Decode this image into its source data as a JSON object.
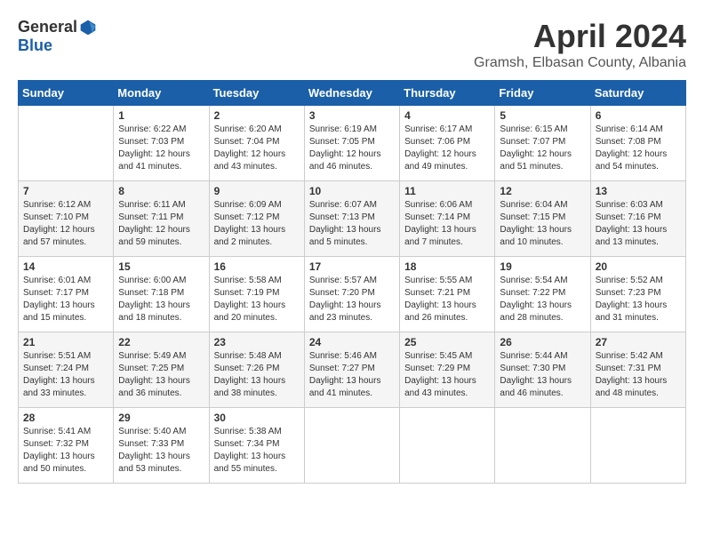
{
  "header": {
    "logo_general": "General",
    "logo_blue": "Blue",
    "month": "April 2024",
    "location": "Gramsh, Elbasan County, Albania"
  },
  "days_of_week": [
    "Sunday",
    "Monday",
    "Tuesday",
    "Wednesday",
    "Thursday",
    "Friday",
    "Saturday"
  ],
  "weeks": [
    [
      {
        "day": "",
        "sunrise": "",
        "sunset": "",
        "daylight": ""
      },
      {
        "day": "1",
        "sunrise": "Sunrise: 6:22 AM",
        "sunset": "Sunset: 7:03 PM",
        "daylight": "Daylight: 12 hours and 41 minutes."
      },
      {
        "day": "2",
        "sunrise": "Sunrise: 6:20 AM",
        "sunset": "Sunset: 7:04 PM",
        "daylight": "Daylight: 12 hours and 43 minutes."
      },
      {
        "day": "3",
        "sunrise": "Sunrise: 6:19 AM",
        "sunset": "Sunset: 7:05 PM",
        "daylight": "Daylight: 12 hours and 46 minutes."
      },
      {
        "day": "4",
        "sunrise": "Sunrise: 6:17 AM",
        "sunset": "Sunset: 7:06 PM",
        "daylight": "Daylight: 12 hours and 49 minutes."
      },
      {
        "day": "5",
        "sunrise": "Sunrise: 6:15 AM",
        "sunset": "Sunset: 7:07 PM",
        "daylight": "Daylight: 12 hours and 51 minutes."
      },
      {
        "day": "6",
        "sunrise": "Sunrise: 6:14 AM",
        "sunset": "Sunset: 7:08 PM",
        "daylight": "Daylight: 12 hours and 54 minutes."
      }
    ],
    [
      {
        "day": "7",
        "sunrise": "Sunrise: 6:12 AM",
        "sunset": "Sunset: 7:10 PM",
        "daylight": "Daylight: 12 hours and 57 minutes."
      },
      {
        "day": "8",
        "sunrise": "Sunrise: 6:11 AM",
        "sunset": "Sunset: 7:11 PM",
        "daylight": "Daylight: 12 hours and 59 minutes."
      },
      {
        "day": "9",
        "sunrise": "Sunrise: 6:09 AM",
        "sunset": "Sunset: 7:12 PM",
        "daylight": "Daylight: 13 hours and 2 minutes."
      },
      {
        "day": "10",
        "sunrise": "Sunrise: 6:07 AM",
        "sunset": "Sunset: 7:13 PM",
        "daylight": "Daylight: 13 hours and 5 minutes."
      },
      {
        "day": "11",
        "sunrise": "Sunrise: 6:06 AM",
        "sunset": "Sunset: 7:14 PM",
        "daylight": "Daylight: 13 hours and 7 minutes."
      },
      {
        "day": "12",
        "sunrise": "Sunrise: 6:04 AM",
        "sunset": "Sunset: 7:15 PM",
        "daylight": "Daylight: 13 hours and 10 minutes."
      },
      {
        "day": "13",
        "sunrise": "Sunrise: 6:03 AM",
        "sunset": "Sunset: 7:16 PM",
        "daylight": "Daylight: 13 hours and 13 minutes."
      }
    ],
    [
      {
        "day": "14",
        "sunrise": "Sunrise: 6:01 AM",
        "sunset": "Sunset: 7:17 PM",
        "daylight": "Daylight: 13 hours and 15 minutes."
      },
      {
        "day": "15",
        "sunrise": "Sunrise: 6:00 AM",
        "sunset": "Sunset: 7:18 PM",
        "daylight": "Daylight: 13 hours and 18 minutes."
      },
      {
        "day": "16",
        "sunrise": "Sunrise: 5:58 AM",
        "sunset": "Sunset: 7:19 PM",
        "daylight": "Daylight: 13 hours and 20 minutes."
      },
      {
        "day": "17",
        "sunrise": "Sunrise: 5:57 AM",
        "sunset": "Sunset: 7:20 PM",
        "daylight": "Daylight: 13 hours and 23 minutes."
      },
      {
        "day": "18",
        "sunrise": "Sunrise: 5:55 AM",
        "sunset": "Sunset: 7:21 PM",
        "daylight": "Daylight: 13 hours and 26 minutes."
      },
      {
        "day": "19",
        "sunrise": "Sunrise: 5:54 AM",
        "sunset": "Sunset: 7:22 PM",
        "daylight": "Daylight: 13 hours and 28 minutes."
      },
      {
        "day": "20",
        "sunrise": "Sunrise: 5:52 AM",
        "sunset": "Sunset: 7:23 PM",
        "daylight": "Daylight: 13 hours and 31 minutes."
      }
    ],
    [
      {
        "day": "21",
        "sunrise": "Sunrise: 5:51 AM",
        "sunset": "Sunset: 7:24 PM",
        "daylight": "Daylight: 13 hours and 33 minutes."
      },
      {
        "day": "22",
        "sunrise": "Sunrise: 5:49 AM",
        "sunset": "Sunset: 7:25 PM",
        "daylight": "Daylight: 13 hours and 36 minutes."
      },
      {
        "day": "23",
        "sunrise": "Sunrise: 5:48 AM",
        "sunset": "Sunset: 7:26 PM",
        "daylight": "Daylight: 13 hours and 38 minutes."
      },
      {
        "day": "24",
        "sunrise": "Sunrise: 5:46 AM",
        "sunset": "Sunset: 7:27 PM",
        "daylight": "Daylight: 13 hours and 41 minutes."
      },
      {
        "day": "25",
        "sunrise": "Sunrise: 5:45 AM",
        "sunset": "Sunset: 7:29 PM",
        "daylight": "Daylight: 13 hours and 43 minutes."
      },
      {
        "day": "26",
        "sunrise": "Sunrise: 5:44 AM",
        "sunset": "Sunset: 7:30 PM",
        "daylight": "Daylight: 13 hours and 46 minutes."
      },
      {
        "day": "27",
        "sunrise": "Sunrise: 5:42 AM",
        "sunset": "Sunset: 7:31 PM",
        "daylight": "Daylight: 13 hours and 48 minutes."
      }
    ],
    [
      {
        "day": "28",
        "sunrise": "Sunrise: 5:41 AM",
        "sunset": "Sunset: 7:32 PM",
        "daylight": "Daylight: 13 hours and 50 minutes."
      },
      {
        "day": "29",
        "sunrise": "Sunrise: 5:40 AM",
        "sunset": "Sunset: 7:33 PM",
        "daylight": "Daylight: 13 hours and 53 minutes."
      },
      {
        "day": "30",
        "sunrise": "Sunrise: 5:38 AM",
        "sunset": "Sunset: 7:34 PM",
        "daylight": "Daylight: 13 hours and 55 minutes."
      },
      {
        "day": "",
        "sunrise": "",
        "sunset": "",
        "daylight": ""
      },
      {
        "day": "",
        "sunrise": "",
        "sunset": "",
        "daylight": ""
      },
      {
        "day": "",
        "sunrise": "",
        "sunset": "",
        "daylight": ""
      },
      {
        "day": "",
        "sunrise": "",
        "sunset": "",
        "daylight": ""
      }
    ]
  ]
}
